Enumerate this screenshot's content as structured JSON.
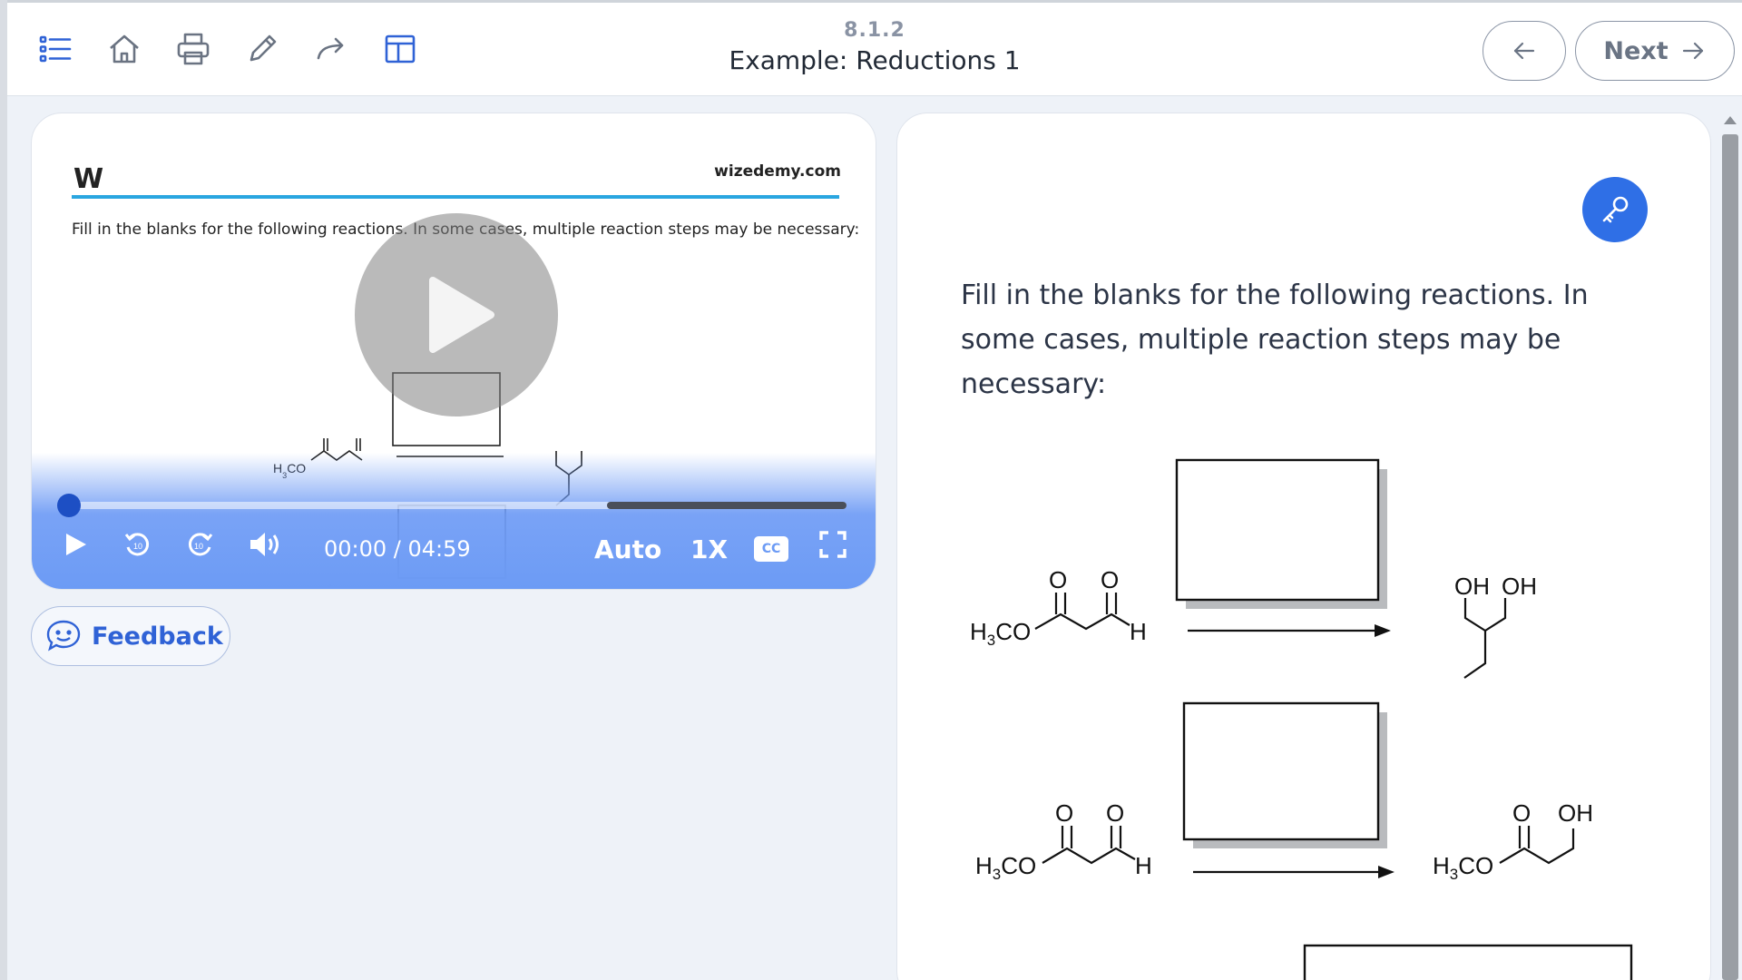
{
  "toolbar": {
    "icons": [
      "list-icon",
      "home-icon",
      "print-icon",
      "pencil-icon",
      "share-icon",
      "layout-icon"
    ]
  },
  "header": {
    "section_number": "8.1.2",
    "title": "Example: Reductions 1",
    "next_label": "Next"
  },
  "video": {
    "slide": {
      "logo": "W",
      "site": "wizedemy.com",
      "instruction": "Fill in the blanks for the following reactions. In some cases, multiple reaction steps may be necessary:"
    },
    "time": "00:00 / 04:59",
    "progress": 0,
    "quality_label": "Auto",
    "speed_label": "1X",
    "cc_label": "CC"
  },
  "feedback_label": "Feedback",
  "content": {
    "prompt": "Fill in the blanks for the following reactions. In some cases, multiple reaction steps may be necessary:",
    "chem_labels": {
      "h3co": "H3CO",
      "h": "H",
      "o": "O",
      "oh": "OH"
    }
  },
  "colors": {
    "accent": "#2f6fe6",
    "slide_rule": "#2aa6e0",
    "controls": "#6c9bf5"
  }
}
